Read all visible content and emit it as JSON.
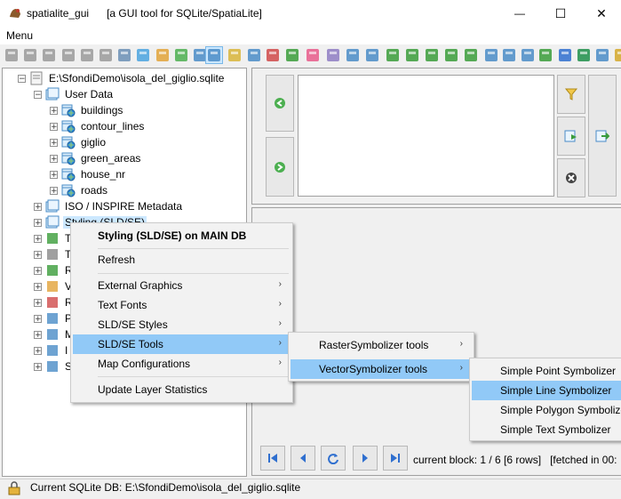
{
  "window": {
    "app_name": "spatialite_gui",
    "subtitle": "[a GUI tool for SQLite/SpatiaLite]",
    "minimize": "—",
    "maximize": "☐",
    "close": "✕"
  },
  "menubar": {
    "menu_label": "Menu"
  },
  "tree": {
    "root": "E:\\SfondiDemo\\isola_del_giglio.sqlite",
    "user_data": "User Data",
    "tables": [
      "buildings",
      "contour_lines",
      "giglio",
      "green_areas",
      "house_nr",
      "roads"
    ],
    "iso_inspire": "ISO / INSPIRE Metadata",
    "styling": "Styling (SLD/SE)",
    "collapsed_prefixes": [
      "T",
      "T",
      "R",
      "V",
      "R",
      "P",
      "M",
      "I",
      "S"
    ]
  },
  "context_menu": {
    "header": "Styling (SLD/SE) on MAIN DB",
    "refresh": "Refresh",
    "external_graphics": "External Graphics",
    "text_fonts": "Text Fonts",
    "sld_se_styles": "SLD/SE Styles",
    "sld_se_tools": "SLD/SE Tools",
    "map_configurations": "Map Configurations",
    "update_layer_statistics": "Update Layer Statistics"
  },
  "submenu_tools": {
    "raster": "RasterSymbolizer tools",
    "vector": "VectorSymbolizer tools"
  },
  "submenu_vector": {
    "point": "Simple Point Symbolizer",
    "line": "Simple Line Symbolizer",
    "polygon": "Simple Polygon Symbolizer",
    "text": "Simple Text Symbolizer"
  },
  "result_nav": {
    "block_info": "current block: 1 / 6 [6 rows]",
    "fetched": "[fetched in 00:"
  },
  "status": {
    "text": "Current SQLite DB: E:\\SfondiDemo\\isola_del_giglio.sqlite"
  },
  "colors": {
    "highlight": "#91c9f7",
    "selection": "#cce8ff",
    "tree_table_icon": "#2e8bd8"
  }
}
